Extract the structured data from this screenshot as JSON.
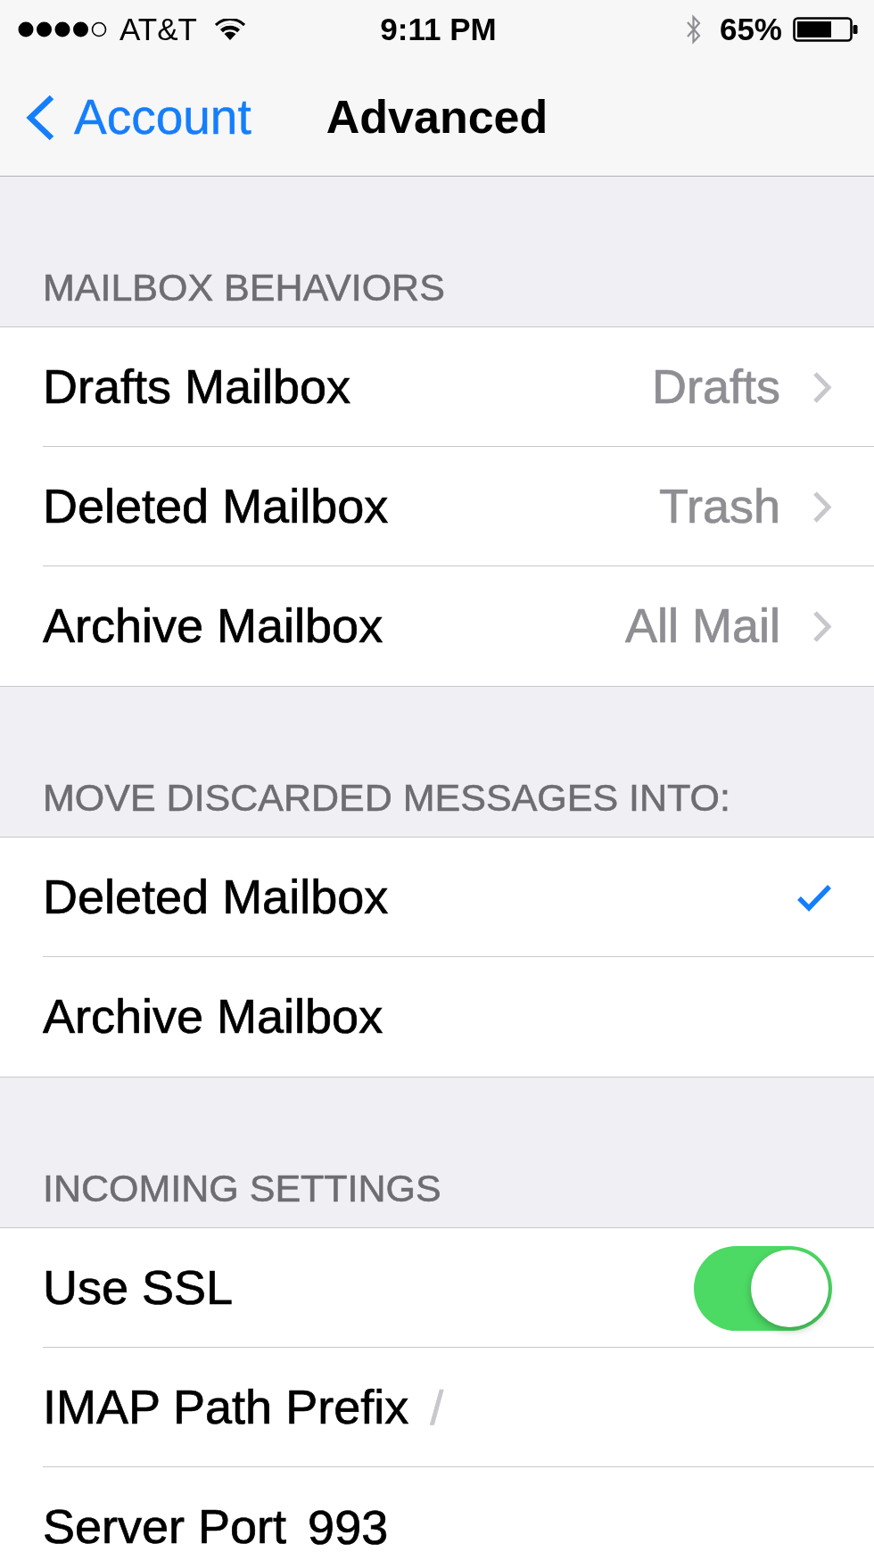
{
  "status_bar": {
    "carrier": "AT&T",
    "time": "9:11 PM",
    "battery": "65%"
  },
  "nav_bar": {
    "back": "Account",
    "title": "Advanced"
  },
  "sections": [
    {
      "header": "MAILBOX BEHAVIORS",
      "rows": [
        {
          "kind": "disclosure",
          "label": "Drafts Mailbox",
          "value": "Drafts"
        },
        {
          "kind": "disclosure",
          "label": "Deleted Mailbox",
          "value": "Trash"
        },
        {
          "kind": "disclosure",
          "label": "Archive Mailbox",
          "value": "All Mail"
        }
      ]
    },
    {
      "header": "MOVE DISCARDED MESSAGES INTO:",
      "rows": [
        {
          "kind": "choice",
          "label": "Deleted Mailbox",
          "selected": true
        },
        {
          "kind": "choice",
          "label": "Archive Mailbox",
          "selected": false
        }
      ]
    },
    {
      "header": "INCOMING SETTINGS",
      "rows": [
        {
          "kind": "switch",
          "label": "Use SSL",
          "on": true
        },
        {
          "kind": "field",
          "label": "IMAP Path Prefix",
          "placeholder": "/"
        },
        {
          "kind": "field",
          "label": "Server Port",
          "value": "993"
        }
      ]
    }
  ]
}
